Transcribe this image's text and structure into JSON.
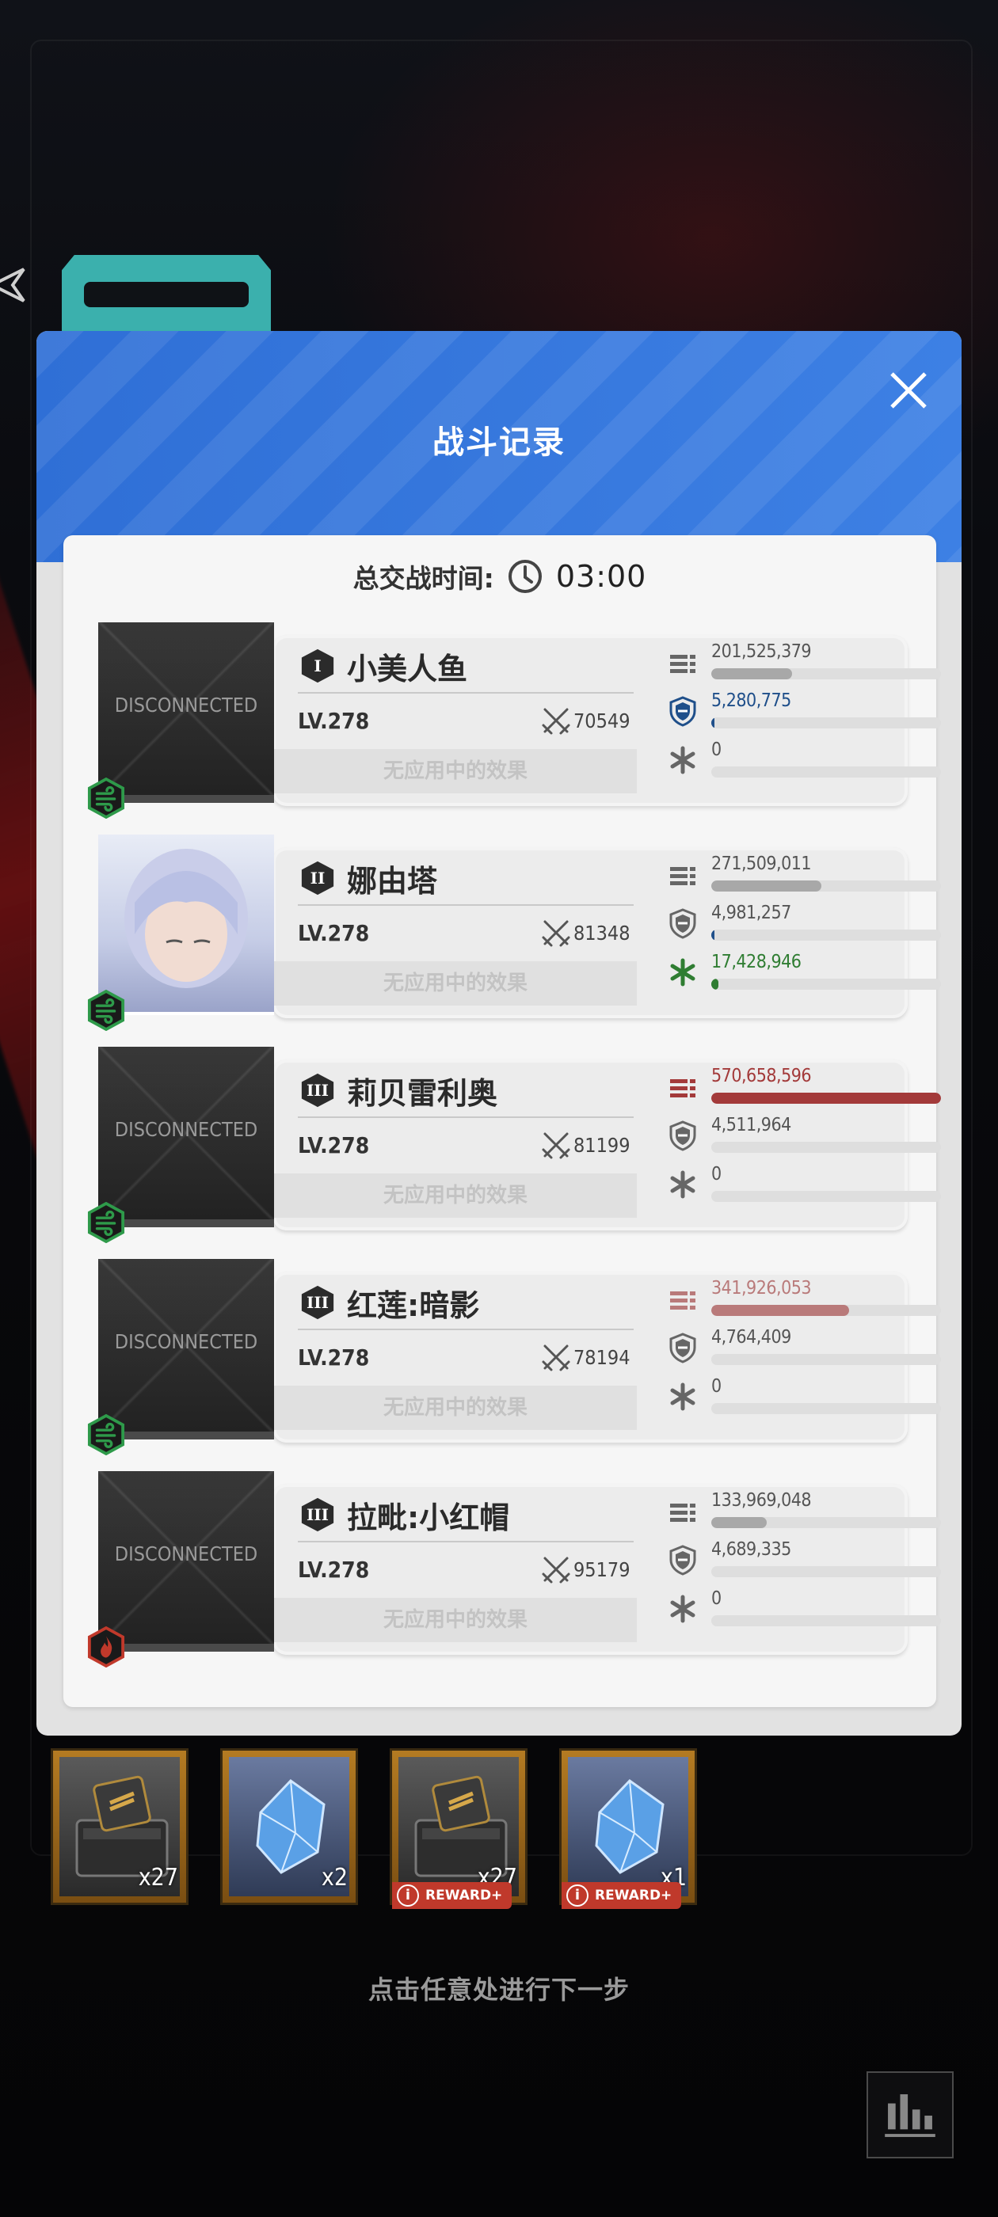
{
  "modal": {
    "title": "战斗记录",
    "duration_label": "总交战时间:",
    "duration_value": "03:00"
  },
  "players": [
    {
      "rank": "I",
      "name": "小美人鱼",
      "level": "LV.278",
      "power": "70549",
      "status": "DISCONNECTED",
      "effect": "无应用中的效果",
      "element": "wind",
      "damage": "201,525,379",
      "damage_ratio": 0.35,
      "shield": "5,280,775",
      "shield_ratio": 0.01,
      "heal": "0",
      "heal_ratio": 0
    },
    {
      "rank": "II",
      "name": "娜由塔",
      "level": "LV.278",
      "power": "81348",
      "status": "",
      "effect": "无应用中的效果",
      "element": "wind",
      "damage": "271,509,011",
      "damage_ratio": 0.48,
      "shield": "4,981,257",
      "shield_ratio": 0.01,
      "heal": "17,428,946",
      "heal_ratio": 0.03
    },
    {
      "rank": "III",
      "name": "莉贝雷利奥",
      "level": "LV.278",
      "power": "81199",
      "status": "DISCONNECTED",
      "effect": "无应用中的效果",
      "element": "wind",
      "damage": "570,658,596",
      "damage_ratio": 1.0,
      "shield": "4,511,964",
      "shield_ratio": 0.0,
      "heal": "0",
      "heal_ratio": 0
    },
    {
      "rank": "III",
      "name": "红莲:暗影",
      "level": "LV.278",
      "power": "78194",
      "status": "DISCONNECTED",
      "effect": "无应用中的效果",
      "element": "wind",
      "damage": "341,926,053",
      "damage_ratio": 0.6,
      "shield": "4,764,409",
      "shield_ratio": 0.0,
      "heal": "0",
      "heal_ratio": 0
    },
    {
      "rank": "III",
      "name": "拉毗:小红帽",
      "level": "LV.278",
      "power": "95179",
      "status": "DISCONNECTED",
      "effect": "无应用中的效果",
      "element": "fire",
      "damage": "133,969,048",
      "damage_ratio": 0.24,
      "shield": "4,689,335",
      "shield_ratio": 0.0,
      "heal": "0",
      "heal_ratio": 0
    }
  ],
  "rewards": [
    {
      "item": "chest-icon",
      "qty": "x27",
      "tag": ""
    },
    {
      "item": "crystal-icon",
      "qty": "x2",
      "tag": ""
    },
    {
      "item": "chest-icon",
      "qty": "x27",
      "tag": "REWARD+"
    },
    {
      "item": "crystal-icon",
      "qty": "x1",
      "tag": "REWARD+"
    }
  ],
  "hint": "点击任意处进行下一步",
  "colors": {
    "header_blue": "#3478dc",
    "damage_top": "#a33a3a",
    "damage_second": "#b97a7a",
    "damage_normal": "#a8a8a8",
    "shield": "#1f4f8a",
    "heal": "#2f7d32",
    "wind_badge": "#2e9a4a",
    "fire_badge": "#c0392b"
  }
}
